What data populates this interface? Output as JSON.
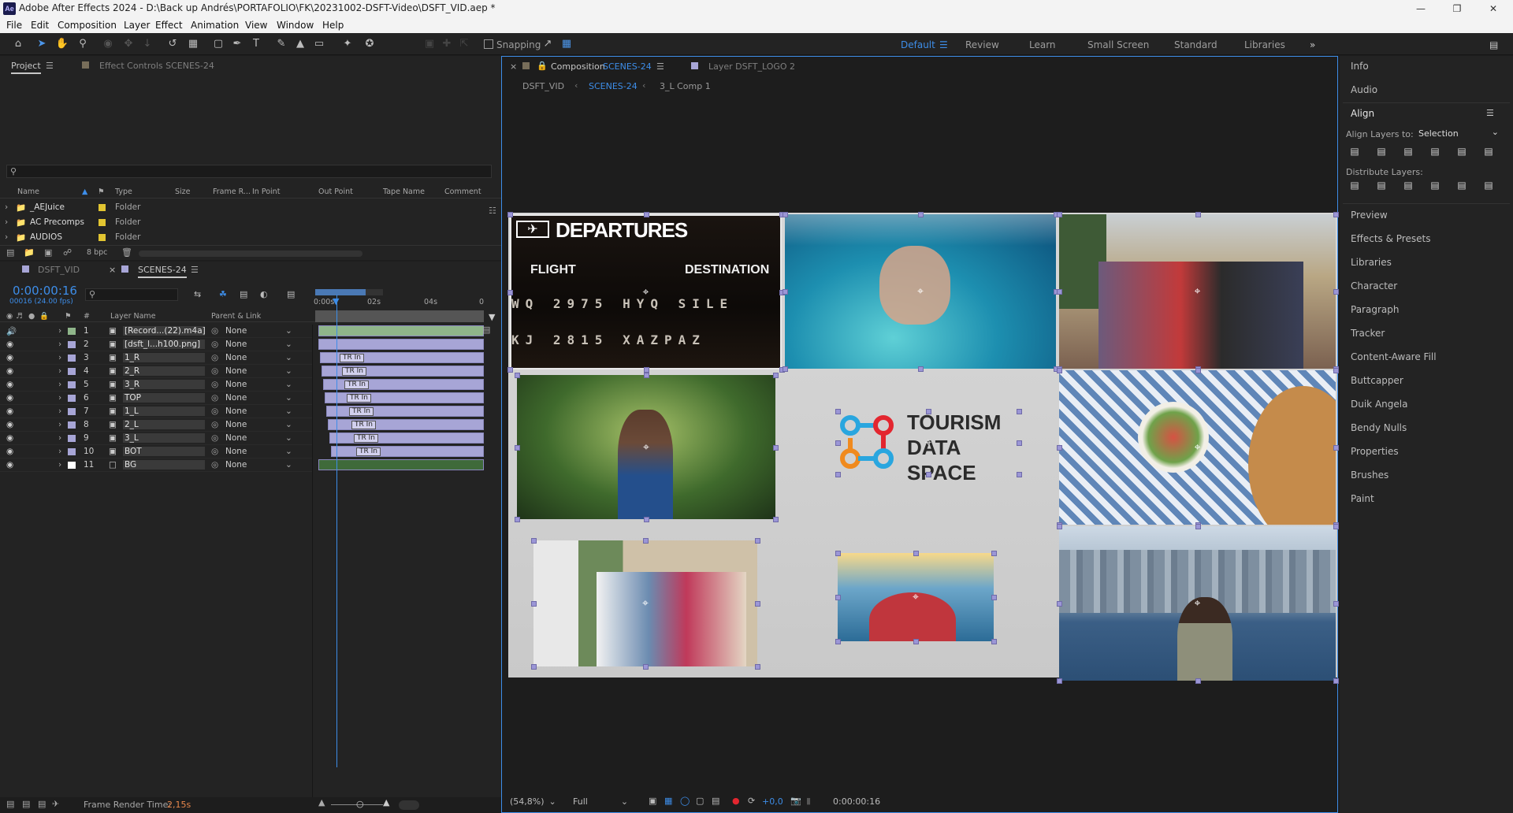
{
  "window": {
    "title": "Adobe After Effects 2024 - D:\\Back up Andrés\\PORTAFOLIO\\FK\\20231002-DSFT-Video\\DSFT_VID.aep *",
    "app_icon": "Ae"
  },
  "menu": [
    "File",
    "Edit",
    "Composition",
    "Layer",
    "Effect",
    "Animation",
    "View",
    "Window",
    "Help"
  ],
  "toolbar": {
    "snapping_label": "Snapping",
    "workspaces": [
      "Default",
      "Review",
      "Learn",
      "Small Screen",
      "Standard",
      "Libraries"
    ],
    "active_workspace": "Default"
  },
  "project": {
    "tab_project": "Project",
    "tab_effect_controls": "Effect Controls SCENES-24",
    "columns": [
      "Name",
      "Type",
      "Size",
      "Frame R...",
      "In Point",
      "Out Point",
      "Tape Name",
      "Comment"
    ],
    "items": [
      {
        "name": "_AEJuice",
        "type": "Folder"
      },
      {
        "name": "AC Precomps",
        "type": "Folder"
      },
      {
        "name": "AUDIOS",
        "type": "Folder"
      }
    ],
    "bpc": "8 bpc"
  },
  "timeline": {
    "tabs": [
      "DSFT_VID",
      "SCENES-24"
    ],
    "timecode": "0:00:00:16",
    "fps": "00016 (24.00 fps)",
    "ruler": [
      "0:00s",
      "02s",
      "04s",
      "0"
    ],
    "col_layer_name": "Layer Name",
    "col_parent": "Parent & Link",
    "col_num": "#",
    "trin_label": "TR In",
    "layers": [
      {
        "num": "1",
        "name": "[Record...(22).m4a]",
        "parent": "None",
        "color": "#8fb58a"
      },
      {
        "num": "2",
        "name": "[dsft_l...h100.png]",
        "parent": "None",
        "color": "#a7a5d6"
      },
      {
        "num": "3",
        "name": "1_R",
        "parent": "None",
        "color": "#a7a5d6"
      },
      {
        "num": "4",
        "name": "2_R",
        "parent": "None",
        "color": "#a7a5d6"
      },
      {
        "num": "5",
        "name": "3_R",
        "parent": "None",
        "color": "#a7a5d6"
      },
      {
        "num": "6",
        "name": "TOP",
        "parent": "None",
        "color": "#a7a5d6"
      },
      {
        "num": "7",
        "name": "1_L",
        "parent": "None",
        "color": "#a7a5d6"
      },
      {
        "num": "8",
        "name": "2_L",
        "parent": "None",
        "color": "#a7a5d6"
      },
      {
        "num": "9",
        "name": "3_L",
        "parent": "None",
        "color": "#a7a5d6"
      },
      {
        "num": "10",
        "name": "BOT",
        "parent": "None",
        "color": "#a7a5d6"
      },
      {
        "num": "11",
        "name": "BG",
        "parent": "None",
        "color": "#ffffff"
      }
    ],
    "render_time_label": "Frame Render Time:",
    "render_time": "2,15s"
  },
  "composition": {
    "tab_label": "Composition",
    "tab_name": "SCENES-24",
    "layer_tab": "Layer  DSFT_LOGO 2",
    "breadcrumbs": [
      "DSFT_VID",
      "SCENES-24",
      "3_L Comp 1"
    ],
    "zoom": "(54,8%)",
    "resolution": "Full",
    "exposure": "+0,0",
    "timecode": "0:00:00:16",
    "board": {
      "title": "DEPARTURES",
      "flight": "FLIGHT",
      "destination": "DESTINATION",
      "row1": "WQ 2975 HYQ SILE",
      "row2": "KJ 2815 XAZPAZ"
    },
    "logo": [
      "TOURISM",
      "DATA",
      "SPACE"
    ]
  },
  "right_panel": {
    "items_top": [
      "Info",
      "Audio"
    ],
    "align_title": "Align",
    "align_to_label": "Align Layers to:",
    "align_to_value": "Selection",
    "distribute_label": "Distribute Layers:",
    "items": [
      "Preview",
      "Effects & Presets",
      "Libraries",
      "Character",
      "Paragraph",
      "Tracker",
      "Content-Aware Fill",
      "Buttcapper",
      "Duik Angela",
      "Bendy Nulls",
      "Properties",
      "Brushes",
      "Paint"
    ]
  },
  "colors": {
    "accent": "#3d8de8",
    "layer_purple": "#a7a5d6",
    "render_time": "#e8874c"
  }
}
